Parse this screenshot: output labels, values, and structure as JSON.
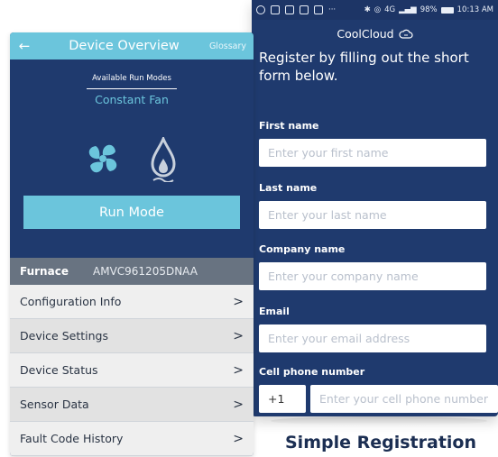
{
  "left_screen": {
    "header": {
      "back_icon": "arrow-left-icon",
      "title": "Device Overview",
      "glossary": "Glossary"
    },
    "run_modes_label": "Available Run Modes",
    "run_mode_value": "Constant Fan",
    "mode_icons": [
      "fan-icon",
      "flame-icon"
    ],
    "run_mode_button": "Run Mode",
    "furnace": {
      "label": "Furnace",
      "model": "AMVC961205DNAA"
    },
    "menu": [
      {
        "label": "Configuration Info"
      },
      {
        "label": "Device Settings"
      },
      {
        "label": "Device Status"
      },
      {
        "label": "Sensor Data"
      },
      {
        "label": "Fault Code History"
      }
    ],
    "chevron": ">"
  },
  "right_screen": {
    "status_bar": {
      "network": "4G",
      "battery": "98%",
      "time": "10:13 AM",
      "more": "···"
    },
    "app_title": "CoolCloud",
    "intro": "Register by filling out the short form below.",
    "fields": [
      {
        "label": "First name",
        "placeholder": "Enter your first name"
      },
      {
        "label": "Last name",
        "placeholder": "Enter your last name"
      },
      {
        "label": "Company name",
        "placeholder": "Enter your company name"
      },
      {
        "label": "Email",
        "placeholder": "Enter your email address"
      },
      {
        "label": "Cell phone number",
        "placeholder": "Enter your cell phone number"
      }
    ],
    "country_code": "+1"
  },
  "caption": "Simple Registration",
  "colors": {
    "navy": "#1f3a6e",
    "accent": "#6bc5dc",
    "furnace_bar": "#687381",
    "menu_light": "#efefef",
    "menu_dark": "#e2e2e2"
  }
}
